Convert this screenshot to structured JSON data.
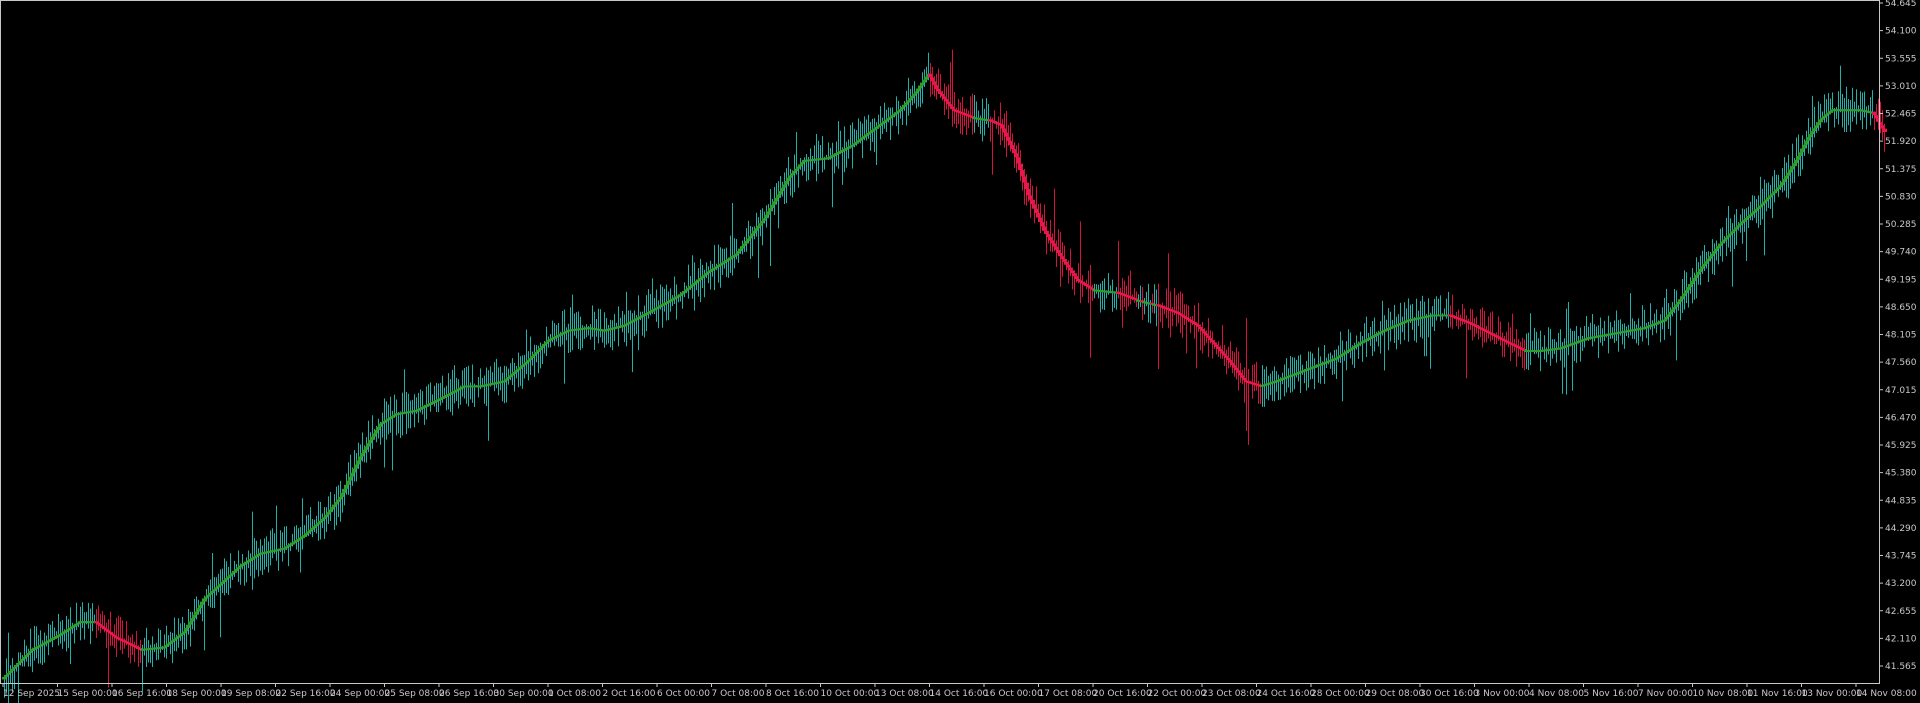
{
  "chart_data": {
    "type": "candlestick",
    "title": "",
    "xlabel": "",
    "ylabel": "",
    "ylim": [
      41.1,
      54.7
    ],
    "grid": false,
    "legend": "none",
    "colors": {
      "background": "#000000",
      "bull_candle": "#2e9c2e",
      "bear_candle": "#e8194a",
      "bull_wick": "#20b2aa",
      "bear_wick": "#d2153e",
      "axis": "#c8c8c8",
      "text": "#c8c8c8"
    },
    "y_ticks": [
      "54.645",
      "54.100",
      "53.555",
      "53.010",
      "52.465",
      "51.920",
      "51.375",
      "50.830",
      "50.285",
      "49.740",
      "49.195",
      "48.650",
      "48.105",
      "47.560",
      "47.015",
      "46.470",
      "45.925",
      "45.380",
      "44.835",
      "44.290",
      "43.745",
      "43.200",
      "42.655",
      "42.110",
      "41.565"
    ],
    "x_ticks": [
      "12 Sep 2025",
      "15 Sep 00:00",
      "16 Sep 16:00",
      "18 Sep 00:00",
      "19 Sep 08:00",
      "22 Sep 16:00",
      "24 Sep 00:00",
      "25 Sep 08:00",
      "26 Sep 16:00",
      "30 Sep 00:00",
      "1 Oct 08:00",
      "2 Oct 16:00",
      "6 Oct 00:00",
      "7 Oct 08:00",
      "8 Oct 16:00",
      "10 Oct 00:00",
      "13 Oct 08:00",
      "14 Oct 16:00",
      "16 Oct 00:00",
      "17 Oct 08:00",
      "20 Oct 16:00",
      "22 Oct 00:00",
      "23 Oct 08:00",
      "24 Oct 16:00",
      "28 Oct 00:00",
      "29 Oct 08:00",
      "30 Oct 16:00",
      "3 Nov 00:00",
      "4 Nov 08:00",
      "5 Nov 16:00",
      "7 Nov 00:00",
      "10 Nov 08:00",
      "11 Nov 16:00",
      "13 Nov 00:00",
      "14 Nov 08:00"
    ],
    "series": [
      {
        "name": "",
        "anchors_close": [
          [
            0,
            41.35
          ],
          [
            14,
            41.9
          ],
          [
            28,
            42.2
          ],
          [
            38,
            42.45
          ],
          [
            45,
            42.45
          ],
          [
            55,
            42.15
          ],
          [
            68,
            41.9
          ],
          [
            80,
            41.95
          ],
          [
            90,
            42.25
          ],
          [
            100,
            42.9
          ],
          [
            118,
            43.55
          ],
          [
            128,
            43.8
          ],
          [
            140,
            43.9
          ],
          [
            150,
            44.15
          ],
          [
            160,
            44.5
          ],
          [
            168,
            44.9
          ],
          [
            178,
            45.7
          ],
          [
            188,
            46.35
          ],
          [
            196,
            46.55
          ],
          [
            206,
            46.62
          ],
          [
            218,
            46.85
          ],
          [
            230,
            47.1
          ],
          [
            238,
            47.1
          ],
          [
            250,
            47.2
          ],
          [
            262,
            47.6
          ],
          [
            272,
            48.0
          ],
          [
            282,
            48.2
          ],
          [
            292,
            48.25
          ],
          [
            300,
            48.2
          ],
          [
            310,
            48.3
          ],
          [
            322,
            48.55
          ],
          [
            338,
            48.9
          ],
          [
            352,
            49.35
          ],
          [
            366,
            49.7
          ],
          [
            380,
            50.4
          ],
          [
            392,
            51.2
          ],
          [
            400,
            51.55
          ],
          [
            412,
            51.6
          ],
          [
            424,
            51.85
          ],
          [
            436,
            52.2
          ],
          [
            448,
            52.55
          ],
          [
            456,
            52.9
          ],
          [
            462,
            53.25
          ],
          [
            466,
            52.95
          ],
          [
            474,
            52.55
          ],
          [
            484,
            52.4
          ],
          [
            492,
            52.35
          ],
          [
            498,
            52.25
          ],
          [
            506,
            51.6
          ],
          [
            512,
            50.85
          ],
          [
            520,
            50.15
          ],
          [
            528,
            49.65
          ],
          [
            536,
            49.2
          ],
          [
            544,
            49.0
          ],
          [
            556,
            48.95
          ],
          [
            566,
            48.8
          ],
          [
            576,
            48.7
          ],
          [
            586,
            48.55
          ],
          [
            596,
            48.3
          ],
          [
            604,
            47.95
          ],
          [
            612,
            47.6
          ],
          [
            620,
            47.2
          ],
          [
            628,
            47.1
          ],
          [
            636,
            47.2
          ],
          [
            646,
            47.35
          ],
          [
            656,
            47.5
          ],
          [
            666,
            47.65
          ],
          [
            678,
            47.95
          ],
          [
            690,
            48.2
          ],
          [
            702,
            48.4
          ],
          [
            714,
            48.5
          ],
          [
            722,
            48.5
          ],
          [
            732,
            48.35
          ],
          [
            742,
            48.15
          ],
          [
            752,
            47.95
          ],
          [
            760,
            47.8
          ],
          [
            768,
            47.8
          ],
          [
            778,
            47.85
          ],
          [
            792,
            48.05
          ],
          [
            806,
            48.15
          ],
          [
            820,
            48.25
          ],
          [
            830,
            48.4
          ],
          [
            838,
            48.8
          ],
          [
            848,
            49.4
          ],
          [
            858,
            49.9
          ],
          [
            868,
            50.3
          ],
          [
            878,
            50.65
          ],
          [
            888,
            51.05
          ],
          [
            896,
            51.55
          ],
          [
            902,
            52.0
          ],
          [
            908,
            52.35
          ],
          [
            914,
            52.55
          ],
          [
            920,
            52.55
          ],
          [
            928,
            52.55
          ],
          [
            934,
            52.5
          ],
          [
            940,
            52.1
          ]
        ]
      }
    ]
  }
}
